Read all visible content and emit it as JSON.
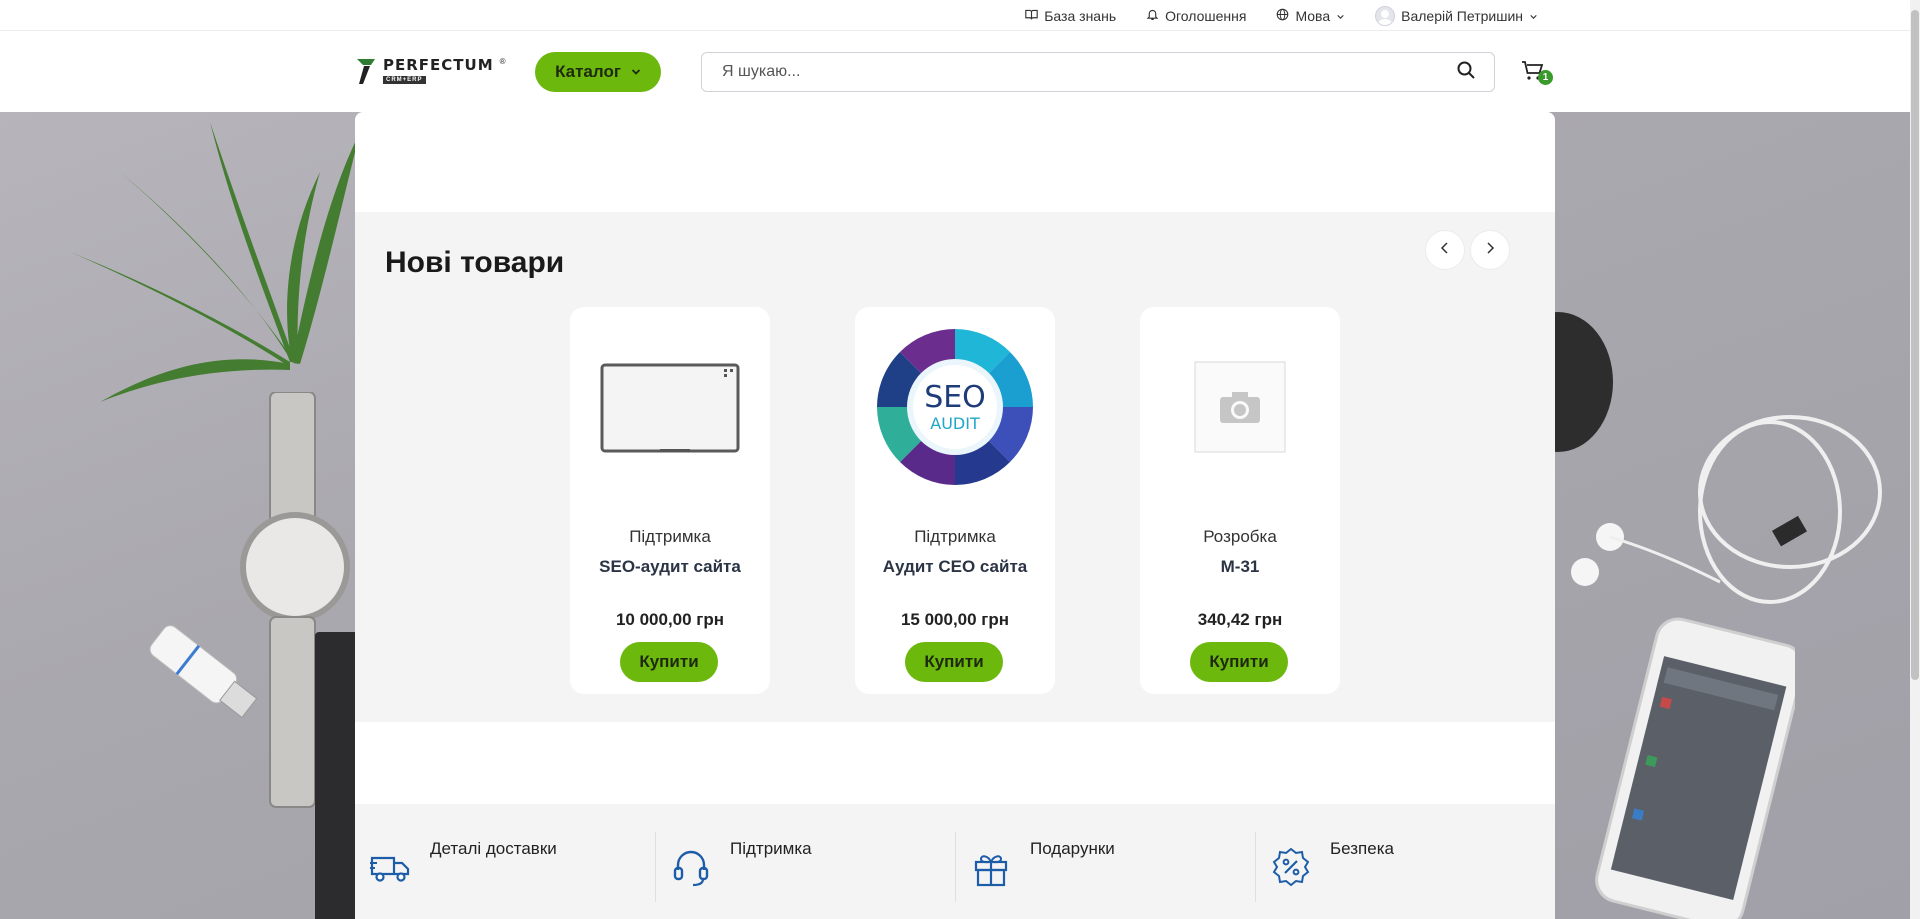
{
  "topbar": {
    "knowledge_base": "База знань",
    "announcements": "Оголошення",
    "language": "Мова",
    "user_name": "Валерій Петришин"
  },
  "header": {
    "logo_name": "PERFECTUM",
    "logo_sub": "CRM+ERP",
    "catalog_label": "Каталог",
    "search_placeholder": "Я шукаю...",
    "cart_count": "1"
  },
  "new_products": {
    "title": "Нові товари",
    "items": [
      {
        "category": "Підтримка",
        "name": "SEO-аудит сайта",
        "price": "10 000,00 грн",
        "buy_label": "Купити",
        "image": "whiteboard"
      },
      {
        "category": "Підтримка",
        "name": "Аудит СЕО сайта",
        "price": "15 000,00 грн",
        "buy_label": "Купити",
        "image": "seo-audit"
      },
      {
        "category": "Розробка",
        "name": "M-31",
        "price": "340,42 грн",
        "buy_label": "Купити",
        "image": "placeholder-camera"
      }
    ]
  },
  "seo_badge": {
    "line1": "SEO",
    "line2": "AUDIT"
  },
  "features": [
    {
      "label": "Деталі доставки",
      "icon": "truck-icon"
    },
    {
      "label": "Підтримка",
      "icon": "headset-icon"
    },
    {
      "label": "Подарунки",
      "icon": "gift-icon"
    },
    {
      "label": "Безпека",
      "icon": "discount-badge-icon"
    }
  ],
  "colors": {
    "accent": "#6db80d",
    "feature_icon": "#1d5da8",
    "badge": "#3a9a2c"
  }
}
